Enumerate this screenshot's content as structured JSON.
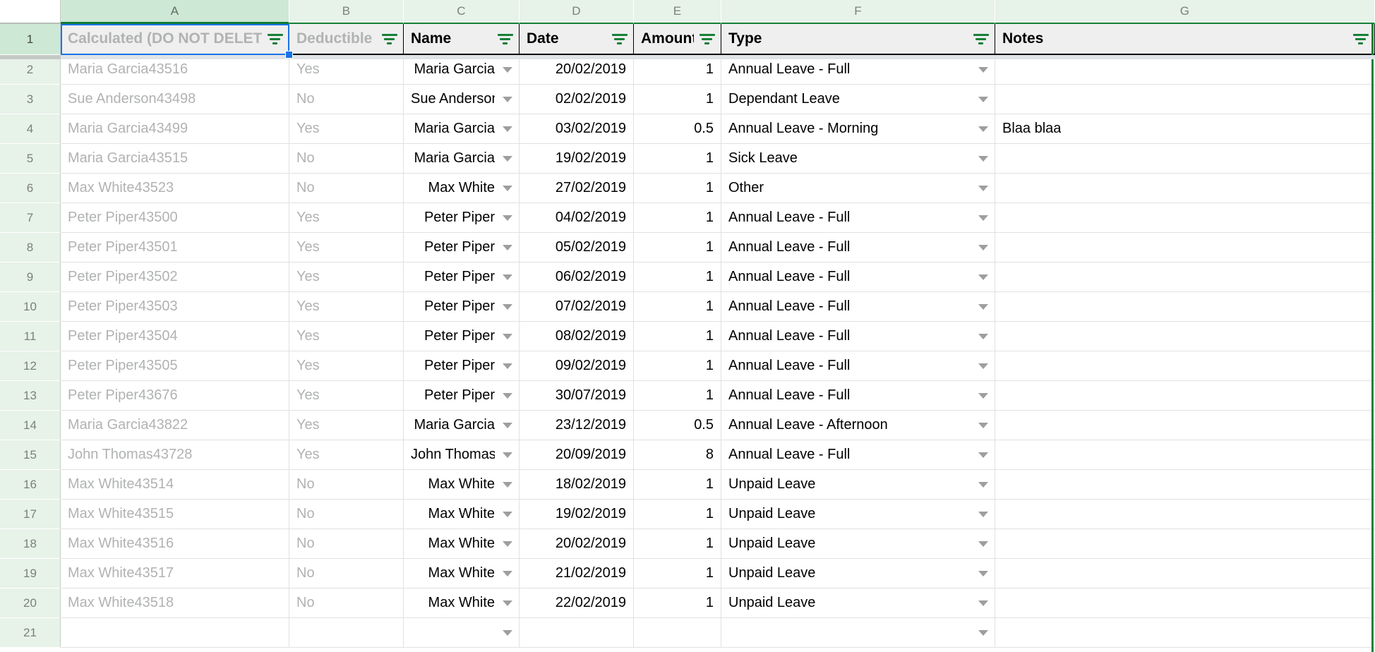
{
  "app": {
    "kind": "spreadsheet"
  },
  "colors": {
    "header_green": "#188038",
    "header_fill": "#e7f2e9",
    "header_fill_selected": "#cde8d5",
    "selection_blue": "#1a73e8",
    "muted_text": "#b0b3b1",
    "banner_fill": "#efefef"
  },
  "column_headers": [
    {
      "letter": "A",
      "selected": true
    },
    {
      "letter": "B",
      "selected": false
    },
    {
      "letter": "C",
      "selected": false
    },
    {
      "letter": "D",
      "selected": false
    },
    {
      "letter": "E",
      "selected": false
    },
    {
      "letter": "F",
      "selected": false
    },
    {
      "letter": "G",
      "selected": false
    }
  ],
  "header_row": {
    "number": "1",
    "cells": [
      {
        "label": "Calculated (DO NOT DELETE)",
        "muted": true,
        "filter": true
      },
      {
        "label": "Deductible",
        "muted": true,
        "filter": true
      },
      {
        "label": "Name",
        "muted": false,
        "filter": true
      },
      {
        "label": "Date",
        "muted": false,
        "filter": true
      },
      {
        "label": "Amount",
        "muted": false,
        "filter": true
      },
      {
        "label": "Type",
        "muted": false,
        "filter": true
      },
      {
        "label": "Notes",
        "muted": false,
        "filter": true
      }
    ]
  },
  "rows": [
    {
      "n": "2",
      "calculated": "Maria Garcia43516",
      "deductible": "Yes",
      "name": "Maria Garcia",
      "date": "20/02/2019",
      "amount": "1",
      "type": "Annual Leave - Full",
      "notes": ""
    },
    {
      "n": "3",
      "calculated": "Sue Anderson43498",
      "deductible": "No",
      "name": "Sue Anderson",
      "date": "02/02/2019",
      "amount": "1",
      "type": "Dependant Leave",
      "notes": ""
    },
    {
      "n": "4",
      "calculated": "Maria Garcia43499",
      "deductible": "Yes",
      "name": "Maria Garcia",
      "date": "03/02/2019",
      "amount": "0.5",
      "type": "Annual Leave - Morning",
      "notes": "Blaa blaa"
    },
    {
      "n": "5",
      "calculated": "Maria Garcia43515",
      "deductible": "No",
      "name": "Maria Garcia",
      "date": "19/02/2019",
      "amount": "1",
      "type": "Sick Leave",
      "notes": ""
    },
    {
      "n": "6",
      "calculated": "Max White43523",
      "deductible": "No",
      "name": "Max White",
      "date": "27/02/2019",
      "amount": "1",
      "type": "Other",
      "notes": ""
    },
    {
      "n": "7",
      "calculated": "Peter Piper43500",
      "deductible": "Yes",
      "name": "Peter Piper",
      "date": "04/02/2019",
      "amount": "1",
      "type": "Annual Leave - Full",
      "notes": ""
    },
    {
      "n": "8",
      "calculated": "Peter Piper43501",
      "deductible": "Yes",
      "name": "Peter Piper",
      "date": "05/02/2019",
      "amount": "1",
      "type": "Annual Leave - Full",
      "notes": ""
    },
    {
      "n": "9",
      "calculated": "Peter Piper43502",
      "deductible": "Yes",
      "name": "Peter Piper",
      "date": "06/02/2019",
      "amount": "1",
      "type": "Annual Leave - Full",
      "notes": ""
    },
    {
      "n": "10",
      "calculated": "Peter Piper43503",
      "deductible": "Yes",
      "name": "Peter Piper",
      "date": "07/02/2019",
      "amount": "1",
      "type": "Annual Leave - Full",
      "notes": ""
    },
    {
      "n": "11",
      "calculated": "Peter Piper43504",
      "deductible": "Yes",
      "name": "Peter Piper",
      "date": "08/02/2019",
      "amount": "1",
      "type": "Annual Leave - Full",
      "notes": ""
    },
    {
      "n": "12",
      "calculated": "Peter Piper43505",
      "deductible": "Yes",
      "name": "Peter Piper",
      "date": "09/02/2019",
      "amount": "1",
      "type": "Annual Leave - Full",
      "notes": ""
    },
    {
      "n": "13",
      "calculated": "Peter Piper43676",
      "deductible": "Yes",
      "name": "Peter Piper",
      "date": "30/07/2019",
      "amount": "1",
      "type": "Annual Leave - Full",
      "notes": ""
    },
    {
      "n": "14",
      "calculated": "Maria Garcia43822",
      "deductible": "Yes",
      "name": "Maria Garcia",
      "date": "23/12/2019",
      "amount": "0.5",
      "type": "Annual Leave - Afternoon",
      "notes": ""
    },
    {
      "n": "15",
      "calculated": "John Thomas43728",
      "deductible": "Yes",
      "name": "John Thomas",
      "date": "20/09/2019",
      "amount": "8",
      "type": "Annual Leave - Full",
      "notes": ""
    },
    {
      "n": "16",
      "calculated": "Max White43514",
      "deductible": "No",
      "name": "Max White",
      "date": "18/02/2019",
      "amount": "1",
      "type": "Unpaid Leave",
      "notes": ""
    },
    {
      "n": "17",
      "calculated": "Max White43515",
      "deductible": "No",
      "name": "Max White",
      "date": "19/02/2019",
      "amount": "1",
      "type": "Unpaid Leave",
      "notes": ""
    },
    {
      "n": "18",
      "calculated": "Max White43516",
      "deductible": "No",
      "name": "Max White",
      "date": "20/02/2019",
      "amount": "1",
      "type": "Unpaid Leave",
      "notes": ""
    },
    {
      "n": "19",
      "calculated": "Max White43517",
      "deductible": "No",
      "name": "Max White",
      "date": "21/02/2019",
      "amount": "1",
      "type": "Unpaid Leave",
      "notes": ""
    },
    {
      "n": "20",
      "calculated": "Max White43518",
      "deductible": "No",
      "name": "Max White",
      "date": "22/02/2019",
      "amount": "1",
      "type": "Unpaid Leave",
      "notes": ""
    },
    {
      "n": "21",
      "calculated": "",
      "deductible": "",
      "name": "",
      "date": "",
      "amount": "",
      "type": "",
      "notes": ""
    }
  ]
}
